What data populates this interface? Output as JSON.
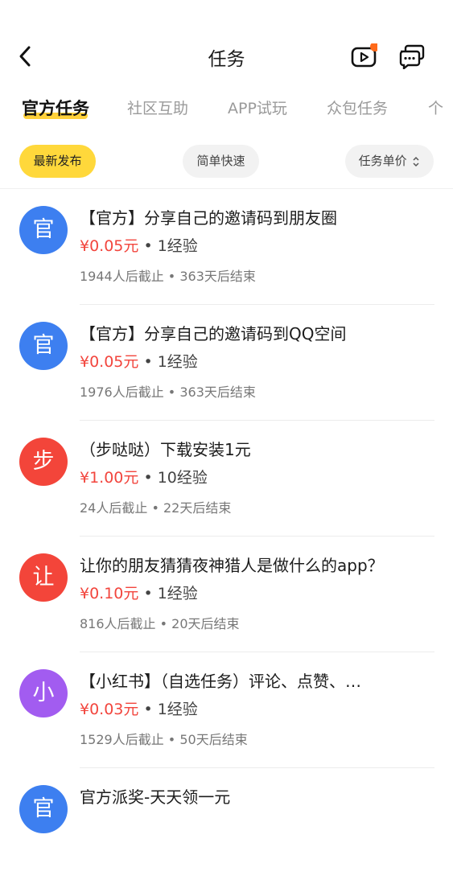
{
  "header": {
    "title": "任务",
    "badge_color": "#ff6a1a"
  },
  "tabs": [
    "官方任务",
    "社区互助",
    "APP试玩",
    "众包任务",
    "个"
  ],
  "filters": {
    "latest": "最新发布",
    "simple": "简单快速",
    "sort": "任务单价",
    "sort_icon": "sort-updown-icon"
  },
  "tasks": [
    {
      "avatar": "官",
      "avatar_color": "#3d7ff0",
      "title": "【官方】分享自己的邀请码到朋友圈",
      "price": "¥0.05元",
      "dot": "•",
      "exp": "1经验",
      "meta": "1944人后截止 • 363天后结束"
    },
    {
      "avatar": "官",
      "avatar_color": "#3d7ff0",
      "title": "【官方】分享自己的邀请码到QQ空间",
      "price": "¥0.05元",
      "dot": "•",
      "exp": "1经验",
      "meta": "1976人后截止 • 363天后结束"
    },
    {
      "avatar": "步",
      "avatar_color": "#f3453a",
      "title": "（步哒哒）下载安装1元",
      "price": "¥1.00元",
      "dot": "•",
      "exp": "10经验",
      "meta": "24人后截止 • 22天后结束"
    },
    {
      "avatar": "让",
      "avatar_color": "#f3453a",
      "title": "让你的朋友猜猜夜神猎人是做什么的app？",
      "price": "¥0.10元",
      "dot": "•",
      "exp": "1经验",
      "meta": "816人后截止 • 20天后结束"
    },
    {
      "avatar": "小",
      "avatar_color": "#a25cf0",
      "title": "【小红书】（自选任务）评论、点赞、…",
      "price": "¥0.03元",
      "dot": "•",
      "exp": "1经验",
      "meta": "1529人后截止 • 50天后结束"
    },
    {
      "avatar": "官",
      "avatar_color": "#3d7ff0",
      "title": "官方派奖-天天领一元",
      "price": "",
      "dot": "",
      "exp": "",
      "meta": ""
    }
  ]
}
